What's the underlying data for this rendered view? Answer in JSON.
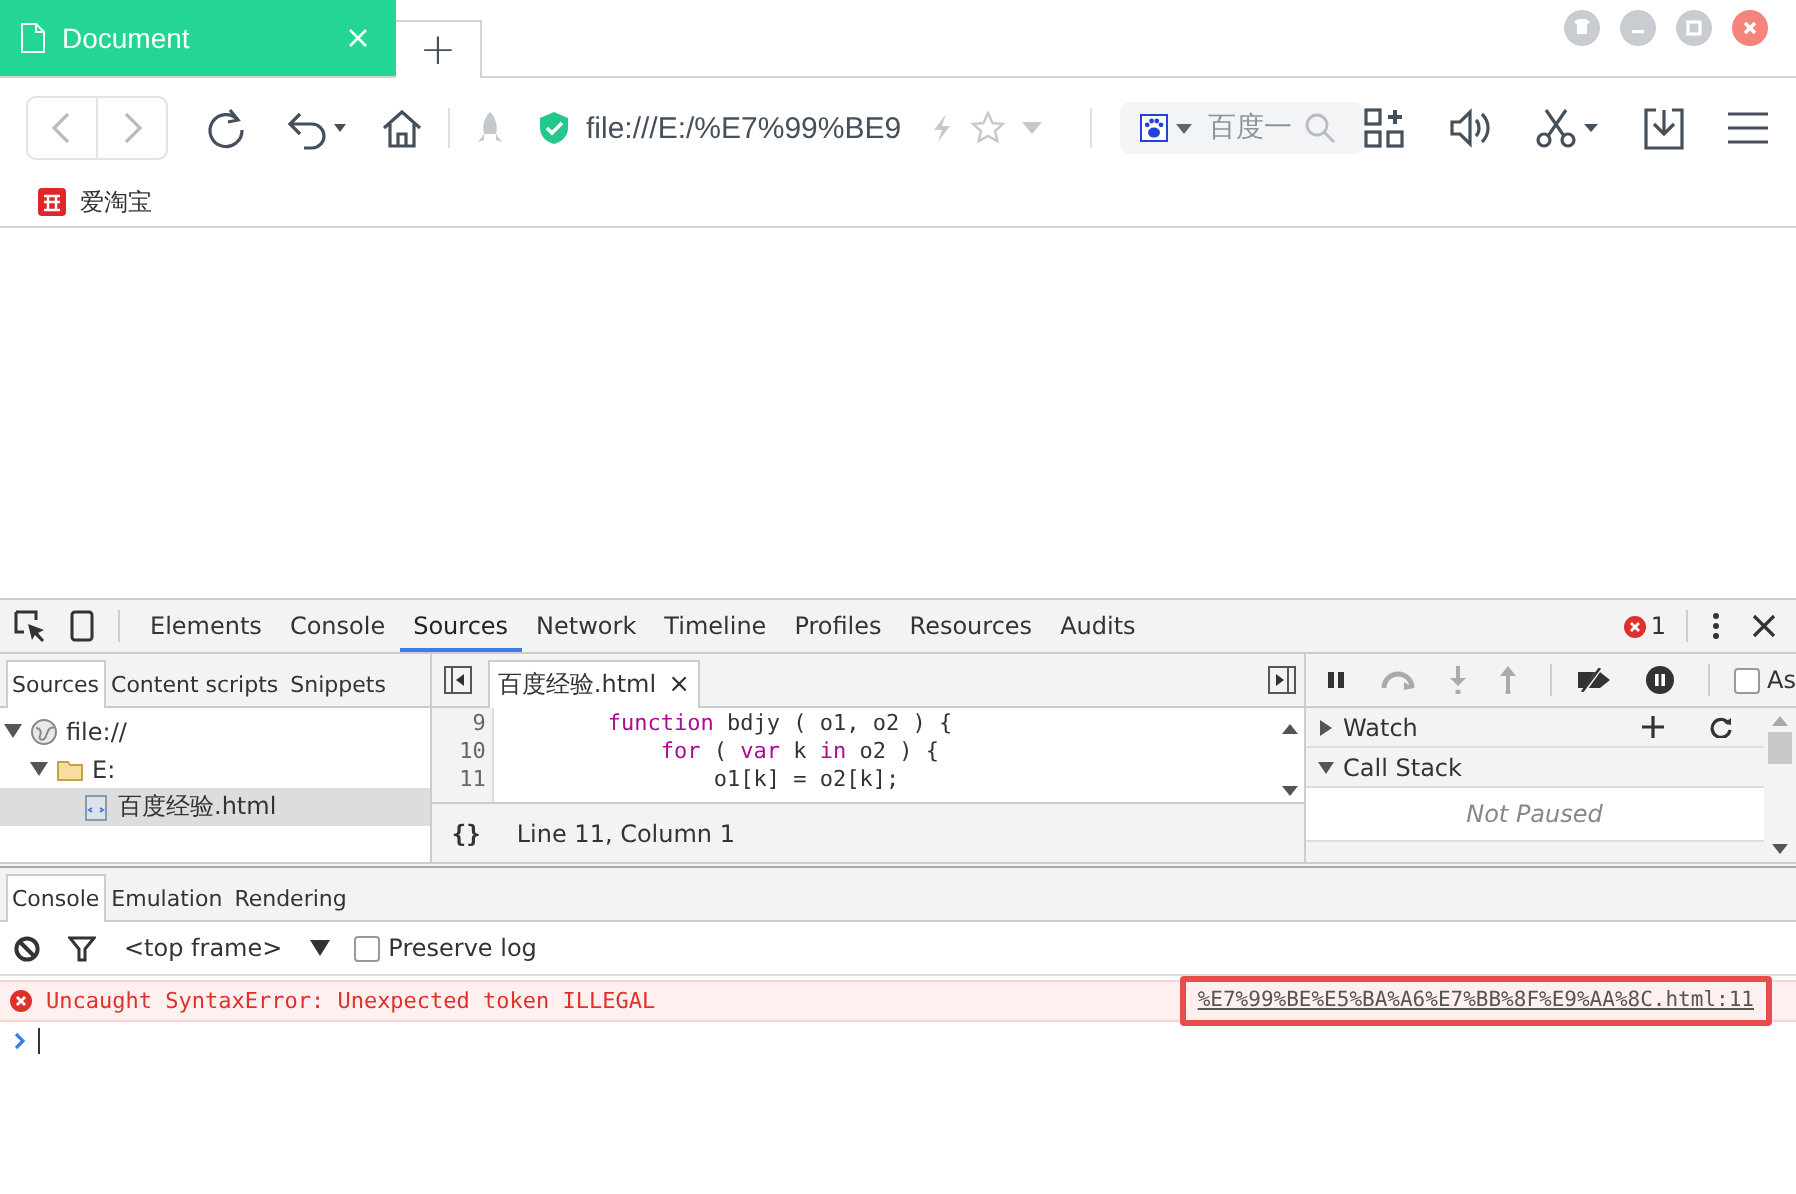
{
  "browser_tabs": [
    {
      "label": "Document",
      "selected": true
    },
    {
      "label": "+",
      "selected": false
    }
  ],
  "address_bar": {
    "url": "file:///E:/%E7%99%BE9"
  },
  "search_box": {
    "placeholder": "百度一"
  },
  "bookmarks": [
    {
      "label": "爱淘宝"
    }
  ],
  "devtools": {
    "tabs": [
      {
        "label": "Elements",
        "selected": false
      },
      {
        "label": "Console",
        "selected": false
      },
      {
        "label": "Sources",
        "selected": true
      },
      {
        "label": "Network",
        "selected": false
      },
      {
        "label": "Timeline",
        "selected": false
      },
      {
        "label": "Profiles",
        "selected": false
      },
      {
        "label": "Resources",
        "selected": false
      },
      {
        "label": "Audits",
        "selected": false
      }
    ],
    "error_count": "1",
    "navigator_tabs": [
      {
        "label": "Sources",
        "selected": true
      },
      {
        "label": "Content scripts",
        "selected": false
      },
      {
        "label": "Snippets",
        "selected": false
      }
    ],
    "file_tree": [
      {
        "label": "file://",
        "kind": "origin",
        "expanded": true,
        "selected": false,
        "children": [
          {
            "label": "E:",
            "kind": "folder",
            "expanded": true,
            "selected": false,
            "children": [
              {
                "label": "百度经验.html",
                "kind": "file",
                "selected": true
              }
            ]
          }
        ]
      }
    ],
    "editor_tab": {
      "label": "百度经验.html",
      "close": "×"
    },
    "code_lines": [
      {
        "number": "9",
        "tokens": [
          {
            "kind": "keyword",
            "text": "        function"
          },
          {
            "kind": "plain",
            "text": " bdjy ( o1, o2 ) {"
          }
        ]
      },
      {
        "number": "10",
        "tokens": [
          {
            "kind": "keyword",
            "text": "            for"
          },
          {
            "kind": "plain",
            "text": " ( "
          },
          {
            "kind": "keyword",
            "text": "var"
          },
          {
            "kind": "plain",
            "text": " k "
          },
          {
            "kind": "keyword",
            "text": "in"
          },
          {
            "kind": "plain",
            "text": " o2 ) {"
          }
        ]
      },
      {
        "number": "11",
        "tokens": [
          {
            "kind": "plain",
            "text": "                o1[k] = o2[k];"
          }
        ]
      }
    ],
    "pretty_print": "{}",
    "cursor_position": "Line 11, Column 1",
    "async_label": "As",
    "async_checked": false,
    "sidebar_sections": [
      {
        "label": "Watch",
        "expanded": false
      },
      {
        "label": "Call Stack",
        "expanded": true,
        "message": "Not Paused"
      }
    ],
    "drawer_tabs": [
      {
        "label": "Console",
        "selected": true
      },
      {
        "label": "Emulation",
        "selected": false
      },
      {
        "label": "Rendering",
        "selected": false
      }
    ],
    "frame_select": "<top frame>",
    "preserve_log": {
      "label": "Preserve log",
      "checked": false
    },
    "messages": [
      {
        "kind": "error",
        "text": "Uncaught SyntaxError: Unexpected token ILLEGAL",
        "source": "%E7%99%BE%E5%BA%A6%E7%BB%8F%E9%AA%8C.html:11",
        "highlighted": true
      }
    ]
  }
}
